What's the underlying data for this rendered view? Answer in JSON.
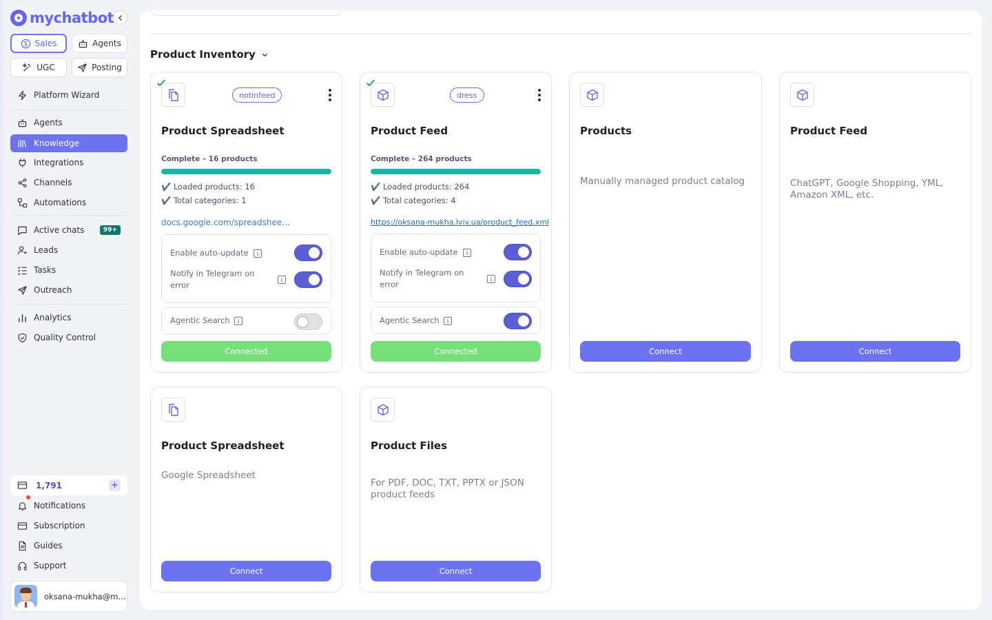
{
  "brand": {
    "name": "mychatbot"
  },
  "modes": [
    {
      "label": "Sales",
      "icon": "dollar-icon",
      "active": true
    },
    {
      "label": "Agents",
      "icon": "robot-icon"
    },
    {
      "label": "UGC",
      "icon": "sparkle-icon"
    },
    {
      "label": "Posting",
      "icon": "send-icon"
    }
  ],
  "nav": {
    "platform_wizard": "Platform Wizard",
    "agents": "Agents",
    "knowledge": "Knowledge",
    "integrations": "Integrations",
    "channels": "Channels",
    "automations": "Automations",
    "active_chats": "Active chats",
    "active_chats_badge": "99+",
    "leads": "Leads",
    "tasks": "Tasks",
    "outreach": "Outreach",
    "analytics": "Analytics",
    "quality_control": "Quality Control"
  },
  "credits": {
    "value": "1,791",
    "add": "+"
  },
  "bottom_nav": {
    "notifications": "Notifications",
    "subscription": "Subscription",
    "guides": "Guides",
    "support": "Support"
  },
  "user": {
    "email": "oksana-mukha@m..."
  },
  "section": {
    "title": "Product Inventory"
  },
  "cards": {
    "c1": {
      "tag": "notinfeed",
      "title": "Product Spreadsheet",
      "status": "Complete – 16 products",
      "progress": 1.0,
      "loaded": "✔️ Loaded products: 16",
      "categories": "✔️ Total categories: 1",
      "link": "docs.google.com/spreadshee...",
      "auto_update": "Enable auto-update",
      "notify": "Notify in Telegram on error",
      "agentic": "Agentic Search",
      "button": "Connected"
    },
    "c2": {
      "tag": "dress",
      "title": "Product Feed",
      "status": "Complete – 264 products",
      "progress": 1.0,
      "loaded": "✔️ Loaded products: 264",
      "categories": "✔️ Total categories: 4",
      "link": "https://oksana-mukha.lviv.ua/product_feed.xml",
      "auto_update": "Enable auto-update",
      "notify": "Notify in Telegram on error",
      "agentic": "Agentic Search",
      "button": "Connected"
    },
    "c3": {
      "title": "Products",
      "desc": "Manually managed product catalog",
      "button": "Connect"
    },
    "c4": {
      "title": "Product Feed",
      "desc": "ChatGPT, Google Shopping, YML, Amazon XML, etc.",
      "button": "Connect"
    },
    "c5": {
      "title": "Product Spreadsheet",
      "desc": "Google Spreadsheet",
      "button": "Connect"
    },
    "c6": {
      "title": "Product Files",
      "desc": "For PDF, DOC, TXT, PPTX or JSON product feeds",
      "button": "Connect"
    }
  },
  "colors": {
    "accent": "#6d72f0",
    "connected": "#77e07a",
    "progress": "#14b8a6"
  }
}
